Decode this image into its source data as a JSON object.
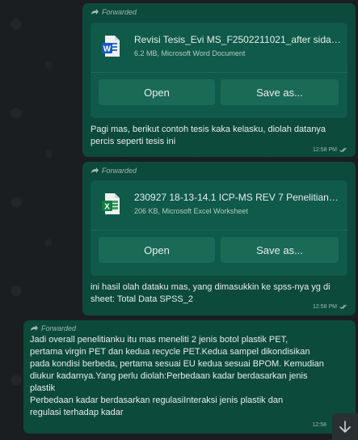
{
  "messages": [
    {
      "forwarded_label": "Forwarded",
      "file_name": "Revisi Tesis_Evi MS_F2502211021_after sidang...",
      "file_meta": "6.2 MB, Microsoft Word Document",
      "file_type_icon": "word-file-icon",
      "open_label": "Open",
      "save_label": "Save as...",
      "caption": "Pagi mas, berikut contoh tesis kaka kelasku, diolah datanya percis seperti tesis ini",
      "time": "12:58 PM"
    },
    {
      "forwarded_label": "Forwarded",
      "file_name": "230927 18-13-14.1 ICP-MS REV 7 Penelitian R...",
      "file_meta": "206 KB, Microsoft Excel Worksheet",
      "file_type_icon": "excel-file-icon",
      "open_label": "Open",
      "save_label": "Save as...",
      "caption": "ini hasil olah dataku mas, yang dimasukkin ke spss-nya yg di sheet: Total Data SPSS_2",
      "time": "12:58 PM"
    },
    {
      "forwarded_label": "Forwarded",
      "text_lines": [
        "Jadi overall penelitianku itu mas meneliti 2 jenis botol plastik PET,",
        "pertama virgin PET dan kedua recycle PET.Kedua sampel dikondisikan",
        "pada kondisi berbeda, pertama sesuai EU kedua sesuai BPOM. Kemudian",
        "diukur kadarnya.Yang perlu diolah:Perbedaan kadar berdasarkan jenis",
        "plastik",
        "Perbedaan kadar berdasarkan regulasiInteraksi jenis plastik dan",
        "regulasi terhadap kadar"
      ],
      "time": "12:58"
    }
  ],
  "colors": {
    "bubble": "#0c4a3b",
    "card": "#0f5a48",
    "button": "#1a6a56",
    "background": "#1b1e21"
  },
  "scroll_icon": "arrow-down-icon"
}
